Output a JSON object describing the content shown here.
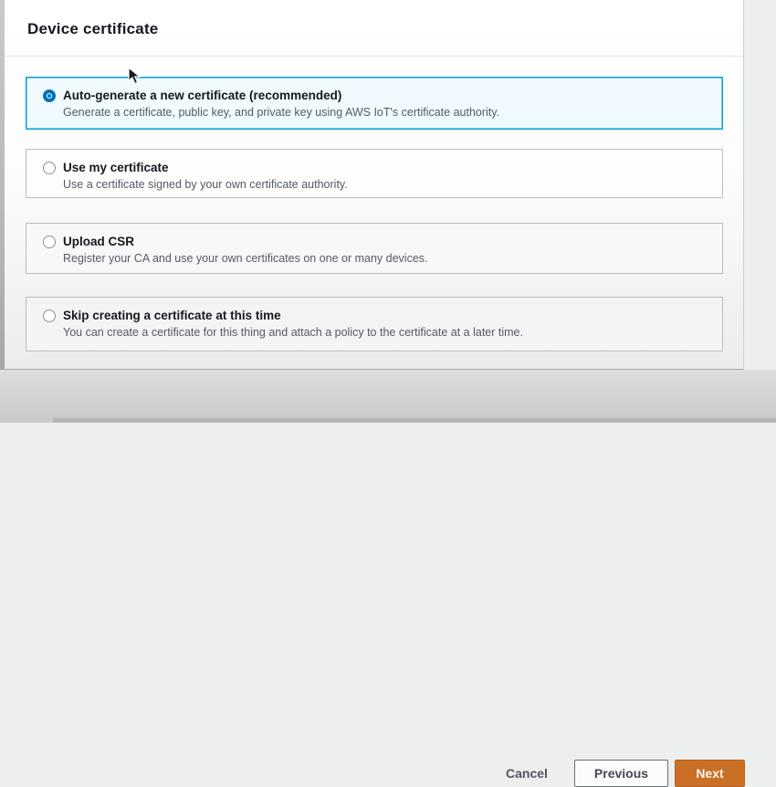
{
  "panel": {
    "title": "Device certificate",
    "options": [
      {
        "title": "Auto-generate a new certificate (recommended)",
        "description": "Generate a certificate, public key, and private key using AWS IoT's certificate authority.",
        "selected": true
      },
      {
        "title": "Use my certificate",
        "description": "Use a certificate signed by your own certificate authority.",
        "selected": false
      },
      {
        "title": "Upload CSR",
        "description": "Register your CA and use your own certificates on one or many devices.",
        "selected": false
      },
      {
        "title": "Skip creating a certificate at this time",
        "description": "You can create a certificate for this thing and attach a policy to the certificate at a later time.",
        "selected": false
      }
    ]
  },
  "footer": {
    "cancel_label": "Cancel",
    "previous_label": "Previous",
    "next_label": "Next"
  },
  "colors": {
    "selected_card_bg": "#f1faff",
    "selected_card_border": "#00a1c9",
    "radio_selected": "#0073bb",
    "next_button_bg": "#c96f26",
    "next_button_text": "#fdf6ee",
    "title_text": "#16191f",
    "description_text": "#545b64"
  }
}
